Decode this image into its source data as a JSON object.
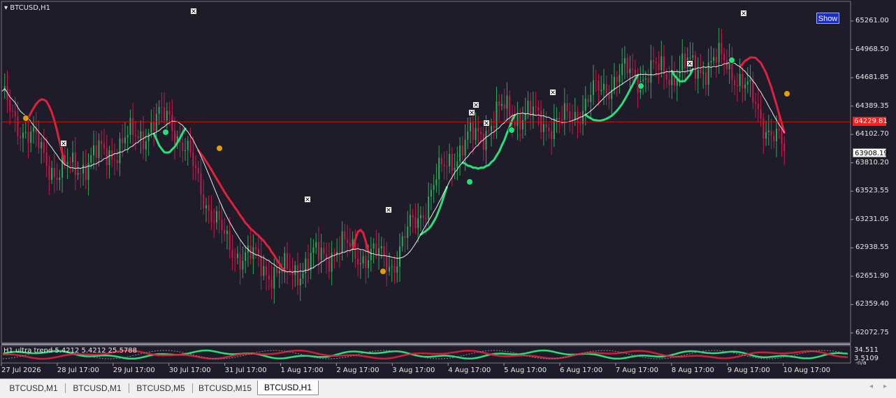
{
  "chart": {
    "symbol_title": "BTCUSD,H1",
    "show_button": "Show",
    "indicator_label": "H1 ultra trend  5.4212 5.4212 25.5788",
    "price_axis": [
      "65261.00",
      "64968.50",
      "64681.85",
      "64389.35",
      "64102.70",
      "63810.20",
      "63523.55",
      "63231.05",
      "62938.55",
      "62651.90",
      "62359.40",
      "62072.75"
    ],
    "current_price": "64229.81",
    "bid_price": "63908.19",
    "sub_axis": [
      "34.511",
      "3.5109"
    ],
    "sub_axis_note": "-n/a",
    "time_axis": [
      "27 Jul 2026",
      "28 Jul 17:00",
      "29 Jul 17:00",
      "30 Jul 17:00",
      "31 Jul 17:00",
      "1 Aug 17:00",
      "2 Aug 17:00",
      "3 Aug 17:00",
      "4 Aug 17:00",
      "5 Aug 17:00",
      "6 Aug 17:00",
      "7 Aug 17:00",
      "8 Aug 17:00",
      "9 Aug 17:00",
      "10 Aug 17:00"
    ],
    "colors": {
      "background": "#1f1c2a",
      "bull_candle": "#2fa85a",
      "bear_candle": "#c8194a",
      "trend_up": "#27e07a",
      "trend_down": "#e0203c",
      "ma_line": "#ffffff",
      "price_line": "#d01010"
    }
  },
  "chart_data": {
    "type": "line",
    "title": "BTCUSD,H1",
    "xlabel": "",
    "ylabel": "",
    "ylim": [
      61950,
      65380
    ],
    "x": [
      "27 Jul 2026",
      "28 Jul 17:00",
      "29 Jul 17:00",
      "30 Jul 17:00",
      "31 Jul 17:00",
      "1 Aug 17:00",
      "2 Aug 17:00",
      "3 Aug 17:00",
      "4 Aug 17:00",
      "5 Aug 17:00",
      "6 Aug 17:00",
      "7 Aug 17:00",
      "8 Aug 17:00",
      "9 Aug 17:00",
      "10 Aug 17:00"
    ],
    "series": [
      {
        "values": [
          64450,
          63700,
          63950,
          64300,
          62980,
          62650,
          62950,
          62800,
          63850,
          64350,
          64200,
          64700,
          64750,
          64850,
          63900
        ]
      }
    ]
  },
  "tabs": [
    "BTCUSD,M1",
    "BTCUSD,M1",
    "BTCUSD,M5",
    "BTCUSD,M15",
    "BTCUSD,H1"
  ],
  "active_tab": "BTCUSD,H1"
}
